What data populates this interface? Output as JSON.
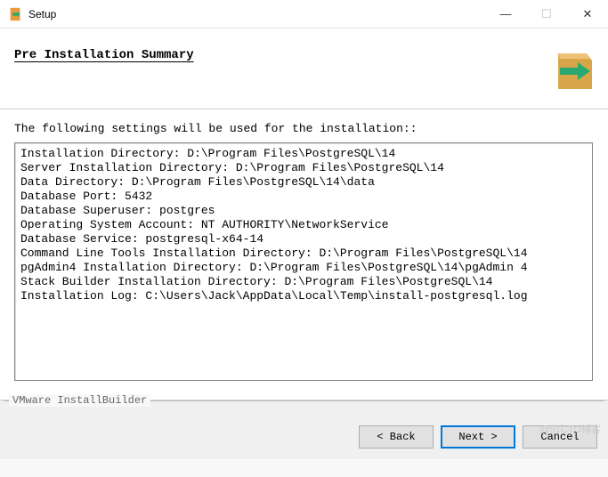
{
  "titlebar": {
    "title": "Setup"
  },
  "header": {
    "title": "Pre Installation Summary"
  },
  "content": {
    "intro": "The following settings will be used for the installation::",
    "summary_lines": [
      "Installation Directory: D:\\Program Files\\PostgreSQL\\14",
      "Server Installation Directory: D:\\Program Files\\PostgreSQL\\14",
      "Data Directory: D:\\Program Files\\PostgreSQL\\14\\data",
      "Database Port: 5432",
      "Database Superuser: postgres",
      "Operating System Account: NT AUTHORITY\\NetworkService",
      "Database Service: postgresql-x64-14",
      "Command Line Tools Installation Directory: D:\\Program Files\\PostgreSQL\\14",
      "pgAdmin4 Installation Directory: D:\\Program Files\\PostgreSQL\\14\\pgAdmin 4",
      "Stack Builder Installation Directory: D:\\Program Files\\PostgreSQL\\14",
      "Installation Log: C:\\Users\\Jack\\AppData\\Local\\Temp\\install-postgresql.log"
    ]
  },
  "footer": {
    "builder": "VMware InstallBuilder",
    "back": "< Back",
    "next": "Next >",
    "cancel": "Cancel"
  },
  "watermark": "@51CTO博客"
}
